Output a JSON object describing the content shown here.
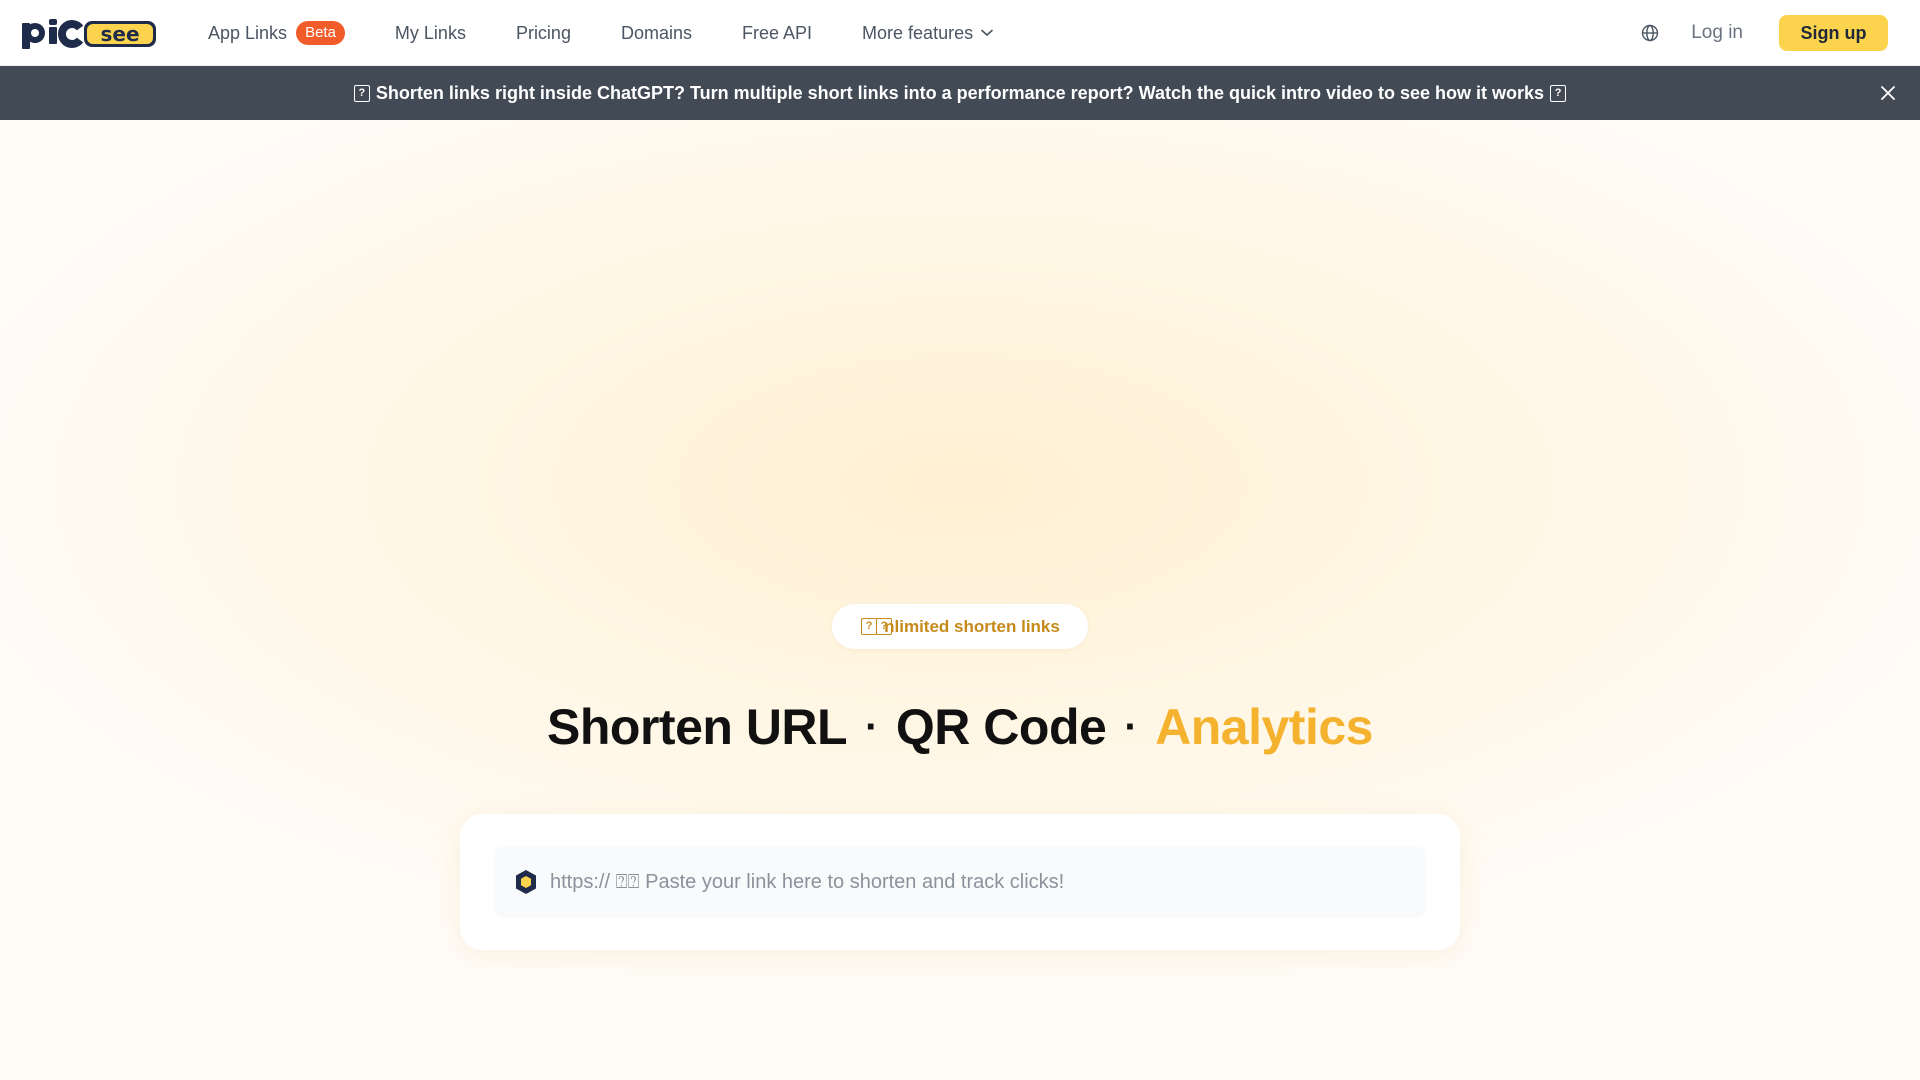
{
  "nav": {
    "logo_alt": "picsee",
    "links": [
      {
        "label": "App Links",
        "badge": "Beta"
      },
      {
        "label": "My Links"
      },
      {
        "label": "Pricing"
      },
      {
        "label": "Domains"
      },
      {
        "label": "Free API"
      },
      {
        "label": "More features"
      }
    ],
    "login_label": "Log in",
    "signup_label": "Sign up"
  },
  "announcement": {
    "text": "Shorten links right inside ChatGPT? Turn multiple short links into a performance report? Watch the quick intro video to see how it works"
  },
  "hero": {
    "pill_text": "nlimited shorten links",
    "headline": {
      "part1": "Shorten URL",
      "part2": "QR Code",
      "part3": "Analytics",
      "separator": "·"
    },
    "input_placeholder": "https:// ⍰⍰ Paste your link here to shorten and track clicks!"
  },
  "colors": {
    "brand_yellow": "#fcd34d",
    "accent_orange": "#f5b22f",
    "badge_red": "#f25c2a",
    "banner_bg": "#414a55",
    "logo_navy": "#1f2b4a"
  }
}
